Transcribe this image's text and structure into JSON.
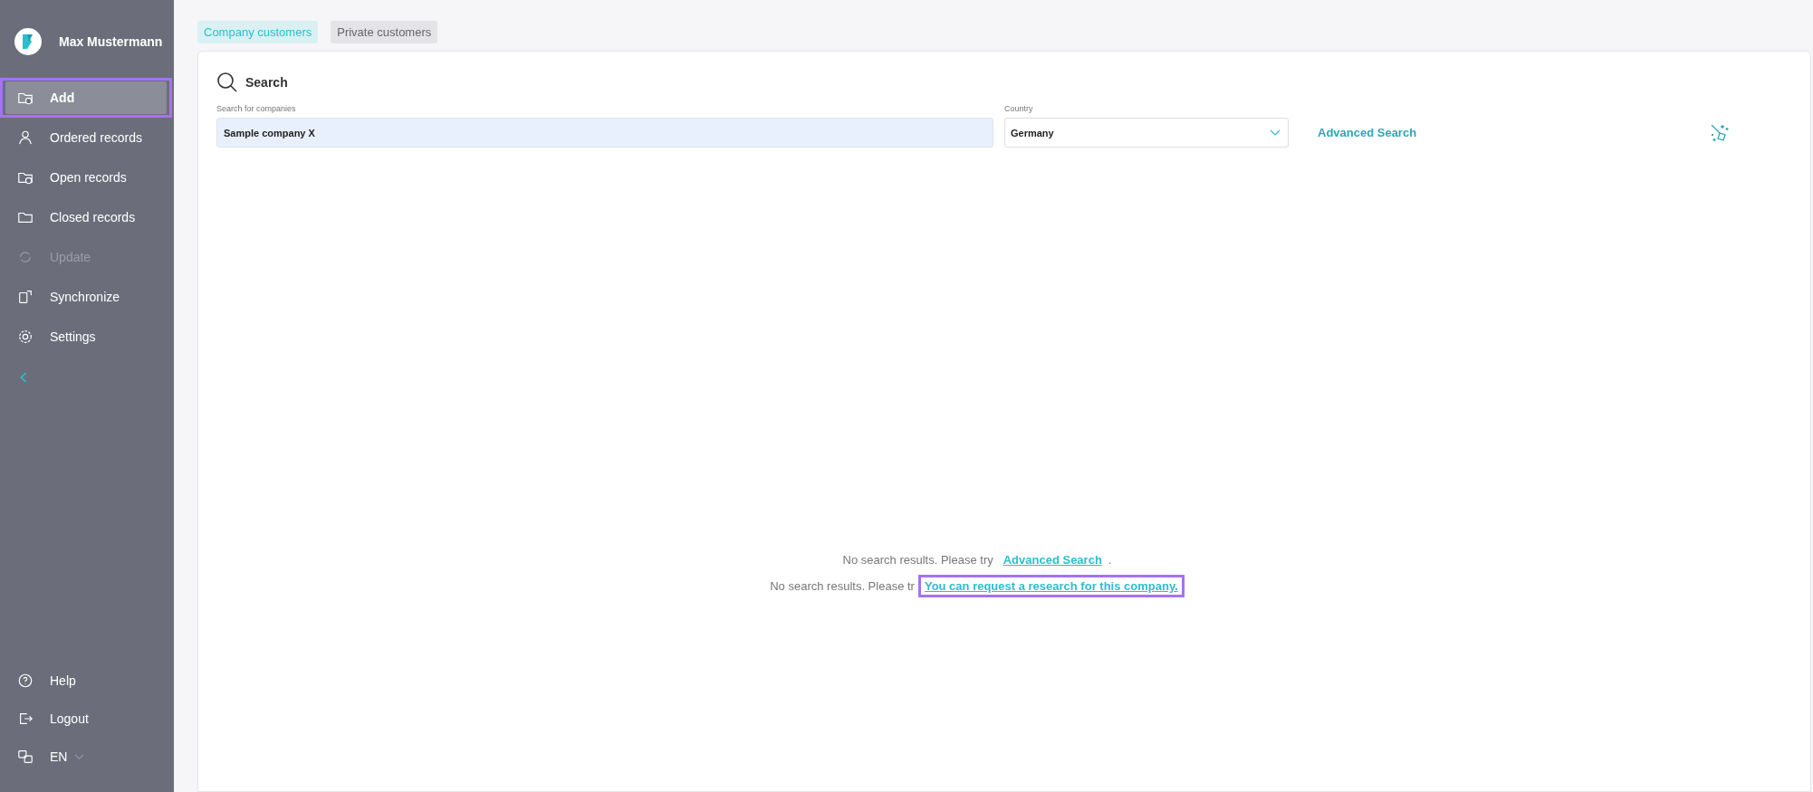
{
  "sidebar": {
    "user_name": "Max Mustermann",
    "items": [
      {
        "label": "Add",
        "selected": true,
        "disabled": false,
        "highlighted": true
      },
      {
        "label": "Ordered records",
        "selected": false,
        "disabled": false,
        "highlighted": false
      },
      {
        "label": "Open records",
        "selected": false,
        "disabled": false,
        "highlighted": false
      },
      {
        "label": "Closed records",
        "selected": false,
        "disabled": false,
        "highlighted": false
      },
      {
        "label": "Update",
        "selected": false,
        "disabled": true,
        "highlighted": false
      },
      {
        "label": "Synchronize",
        "selected": false,
        "disabled": false,
        "highlighted": false
      },
      {
        "label": "Settings",
        "selected": false,
        "disabled": false,
        "highlighted": false
      }
    ],
    "bottom_items": [
      {
        "label": "Help"
      },
      {
        "label": "Logout"
      }
    ],
    "language": "EN"
  },
  "tabs": [
    {
      "label": "Company customers",
      "selected": true
    },
    {
      "label": "Private customers",
      "selected": false
    }
  ],
  "search": {
    "title": "Search",
    "company_label": "Search for companies",
    "company_value": "Sample company X",
    "country_label": "Country",
    "country_value": "Germany",
    "advanced_link": "Advanced Search"
  },
  "messages": [
    {
      "text": "No search results. Please try",
      "link": "Advanced Search ",
      "suffix": ".",
      "highlighted": false
    },
    {
      "text": "No search results. Please tr",
      "link": "You can request a research for this company.",
      "highlighted": true
    }
  ]
}
